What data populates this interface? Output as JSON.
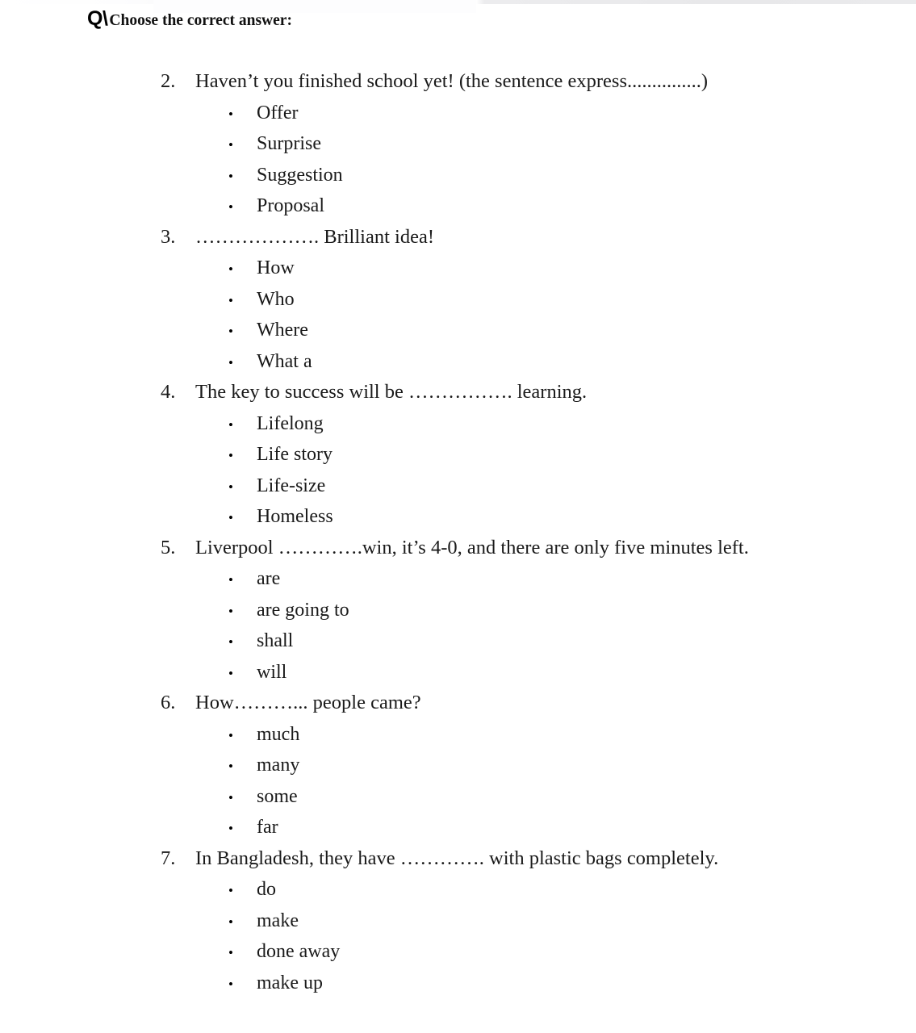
{
  "document": {
    "heading": {
      "marker": "Q\\",
      "title": "Choose the correct answer:"
    },
    "bullet_glyph": "•",
    "questions": [
      {
        "number": "2.",
        "text": "Haven’t you finished school yet! (the sentence express...............)",
        "choices": [
          "Offer",
          "Surprise",
          "Suggestion",
          "Proposal"
        ]
      },
      {
        "number": "3.",
        "text": "………………. Brilliant idea!",
        "choices": [
          "How",
          "Who",
          "Where",
          "What a"
        ]
      },
      {
        "number": "4.",
        "text": "The key to success will be ……………. learning.",
        "choices": [
          "Lifelong",
          "Life story",
          "Life-size",
          "Homeless"
        ]
      },
      {
        "number": "5.",
        "text": "Liverpool ………….win, it’s 4-0, and there are only five minutes left.",
        "choices": [
          "are",
          "are going to",
          "shall",
          "will"
        ]
      },
      {
        "number": "6.",
        "text": "How………... people came?",
        "choices": [
          "much",
          "many",
          "some",
          "far"
        ]
      },
      {
        "number": "7.",
        "text": "In Bangladesh, they have …………. with plastic bags completely.",
        "choices": [
          "do",
          "make",
          "done away",
          "make up"
        ]
      }
    ]
  }
}
